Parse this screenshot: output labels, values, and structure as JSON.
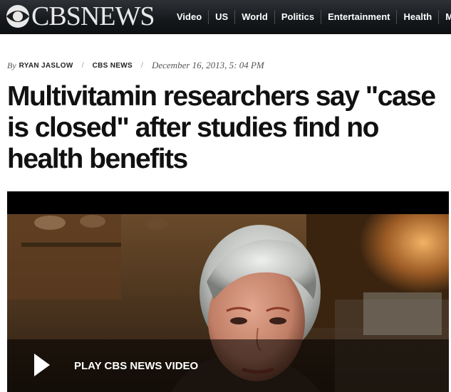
{
  "header": {
    "logo_text": "CBSNEWS",
    "nav": [
      "Video",
      "US",
      "World",
      "Politics",
      "Entertainment",
      "Health",
      "Mon"
    ]
  },
  "article": {
    "byline_prefix": "By",
    "author": "RYAN JASLOW",
    "source": "CBS NEWS",
    "date": "December 16, 2013, 5: 04 PM",
    "headline": "Multivitamin researchers say \"case is closed\" after studies find no health benefits"
  },
  "video": {
    "play_label": "PLAY CBS NEWS VIDEO",
    "play_icon": "play-icon"
  }
}
